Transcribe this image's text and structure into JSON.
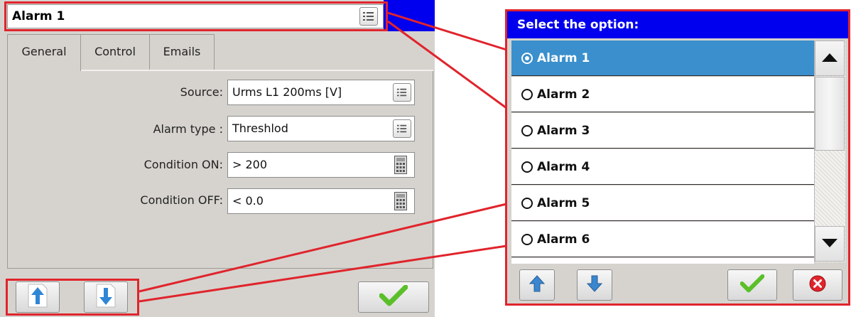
{
  "colors": {
    "accent_blue": "#0000ee",
    "highlight_red": "#e0242c",
    "selected_row": "#3a8fcc",
    "panel_bg": "#d6d3ce",
    "check_green": "#5bbf2a"
  },
  "left": {
    "title": "Alarm 1",
    "tabs": [
      "General",
      "Control",
      "Emails"
    ],
    "fields": [
      {
        "label": "Source:",
        "value": "Urms L1 200ms [V]",
        "icon": "list-icon"
      },
      {
        "label": "Alarm type :",
        "value": "Threshlod",
        "icon": "list-icon"
      },
      {
        "label": "Condition ON:",
        "value": "> 200",
        "icon": "calculator-icon"
      },
      {
        "label": "Condition OFF:",
        "value": "< 0.0",
        "icon": "calculator-icon"
      }
    ],
    "buttons": [
      "up-document-icon",
      "down-document-icon",
      "checkmark-icon"
    ]
  },
  "dialog": {
    "header": "Select the option:",
    "options": [
      "Alarm 1",
      "Alarm 2",
      "Alarm 3",
      "Alarm 4",
      "Alarm 5",
      "Alarm 6"
    ],
    "selected": "Alarm 1",
    "scroll_icons": [
      "triangle-up-icon",
      "triangle-down-icon"
    ],
    "footer_buttons": [
      "arrow-up-icon",
      "arrow-down-icon",
      "checkmark-icon",
      "cancel-icon"
    ]
  }
}
